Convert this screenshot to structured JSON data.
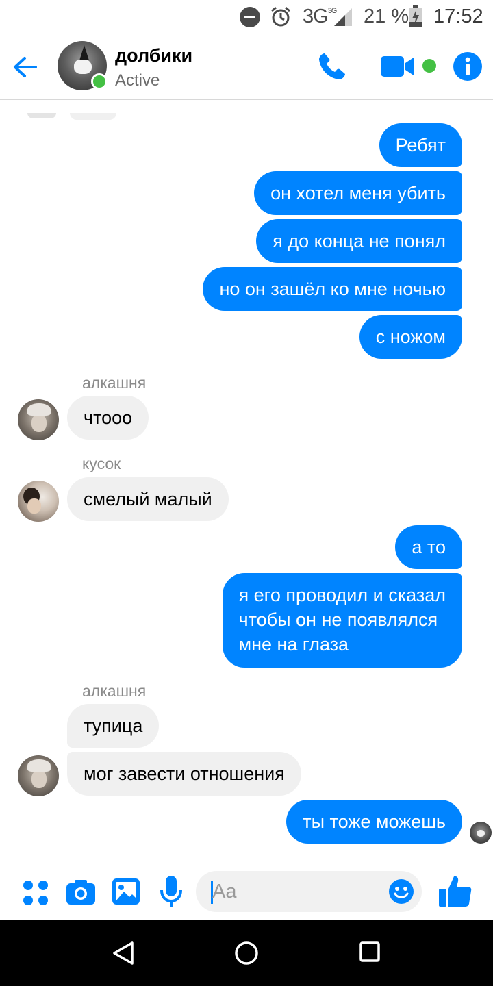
{
  "status_bar": {
    "network": "3G",
    "network_sup": "3G",
    "battery": "21 %",
    "time": "17:52"
  },
  "header": {
    "chat_name": "долбики",
    "status": "Active"
  },
  "messages": [
    {
      "side": "out",
      "text": "Ребят"
    },
    {
      "side": "out",
      "text": "он хотел меня убить"
    },
    {
      "side": "out",
      "text": "я до конца не понял"
    },
    {
      "side": "out",
      "text": "но он зашёл ко мне ночью"
    },
    {
      "side": "out",
      "text": "с ножом"
    },
    {
      "side": "in",
      "sender": "алкашня",
      "text": "чтооо"
    },
    {
      "side": "in",
      "sender": "кусок",
      "text": "смелый малый"
    },
    {
      "side": "out",
      "text": "а то"
    },
    {
      "side": "out",
      "lines": [
        "я его проводил и сказал",
        "чтобы он не появлялся",
        "мне на глаза"
      ]
    },
    {
      "side": "in",
      "sender": "алкашня",
      "text": "тупица"
    },
    {
      "side": "in",
      "text": "мог завести отношения"
    },
    {
      "side": "out",
      "text": "ты тоже можешь"
    }
  ],
  "composer": {
    "placeholder": "Aa"
  },
  "colors": {
    "accent": "#0084ff",
    "incoming_bubble": "#f0f0f0",
    "active_green": "#44c044"
  },
  "icons": [
    "back-arrow-icon",
    "phone-icon",
    "video-camera-icon",
    "info-icon",
    "apps-menu-icon",
    "camera-icon",
    "gallery-icon",
    "microphone-icon",
    "emoji-icon",
    "thumbs-up-icon",
    "nav-back-icon",
    "nav-home-icon",
    "nav-recents-icon"
  ]
}
